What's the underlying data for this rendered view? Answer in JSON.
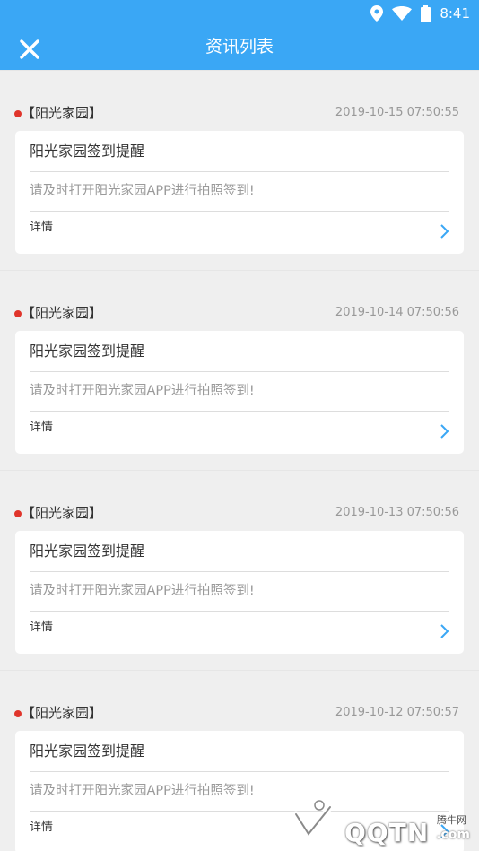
{
  "status_bar": {
    "time": "8:41",
    "icons": [
      "location-icon",
      "wifi-icon",
      "battery-icon"
    ]
  },
  "header": {
    "title": "资讯列表",
    "close_icon": "close-icon"
  },
  "colors": {
    "accent": "#3aa7f5",
    "dot": "#e0352b",
    "chevron": "#3aa7f5",
    "background": "#efefef"
  },
  "items": [
    {
      "source": "【阳光家园】",
      "time": "2019-10-15 07:50:55",
      "title": "阳光家园签到提醒",
      "summary": "请及时打开阳光家园APP进行拍照签到!",
      "detail": "详情"
    },
    {
      "source": "【阳光家园】",
      "time": "2019-10-14 07:50:56",
      "title": "阳光家园签到提醒",
      "summary": "请及时打开阳光家园APP进行拍照签到!",
      "detail": "详情"
    },
    {
      "source": "【阳光家园】",
      "time": "2019-10-13 07:50:56",
      "title": "阳光家园签到提醒",
      "summary": "请及时打开阳光家园APP进行拍照签到!",
      "detail": "详情"
    },
    {
      "source": "【阳光家园】",
      "time": "2019-10-12 07:50:57",
      "title": "阳光家园签到提醒",
      "summary": "请及时打开阳光家园APP进行拍照签到!",
      "detail": "详情"
    }
  ],
  "watermark": {
    "name": "腾牛网",
    "text": "QQTN",
    "suffix": ".com"
  }
}
